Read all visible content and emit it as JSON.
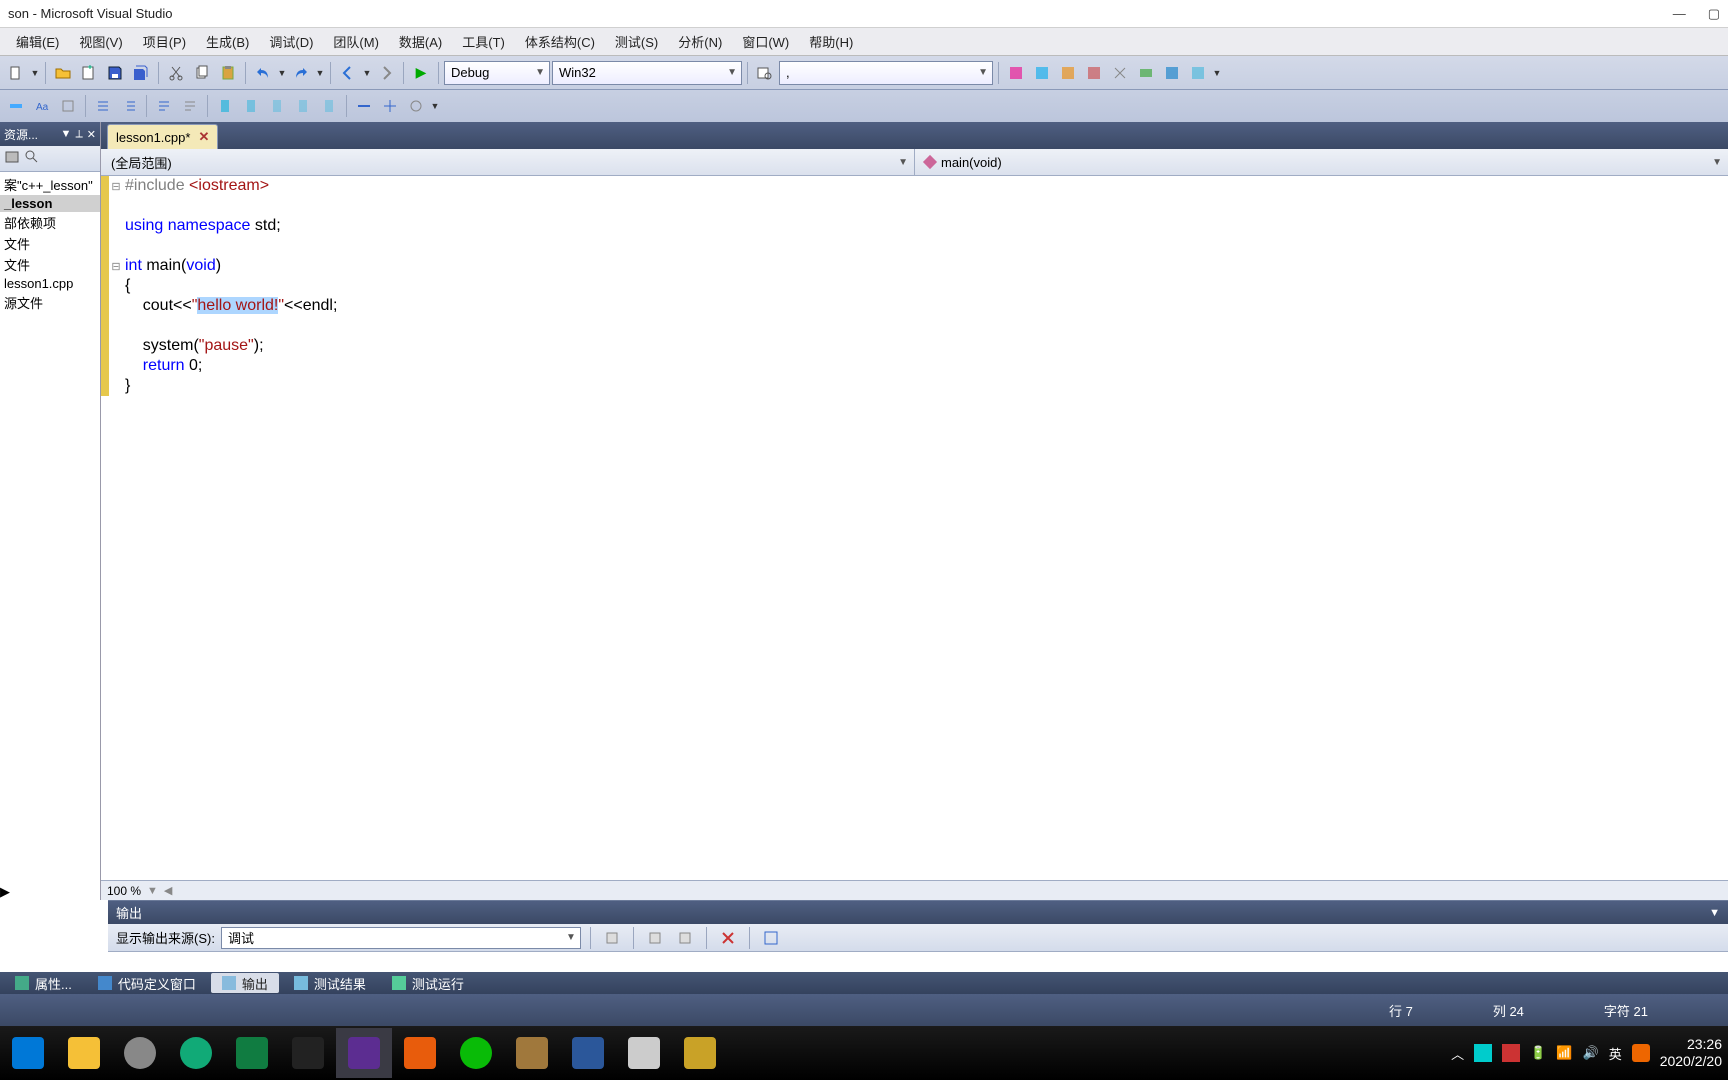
{
  "title": "son - Microsoft Visual Studio",
  "menu": [
    "编辑(E)",
    "视图(V)",
    "项目(P)",
    "生成(B)",
    "调试(D)",
    "团队(M)",
    "数据(A)",
    "工具(T)",
    "体系结构(C)",
    "测试(S)",
    "分析(N)",
    "窗口(W)",
    "帮助(H)"
  ],
  "toolbar": {
    "config": "Debug",
    "platform": "Win32",
    "find": ","
  },
  "explorer": {
    "header": "资源...",
    "root": "案\"c++_lesson\"",
    "items": [
      "_lesson",
      "部依赖项",
      "文件",
      "文件",
      "lesson1.cpp",
      "源文件"
    ],
    "selectedIndex": 0
  },
  "tab": {
    "name": "lesson1.cpp*",
    "dirty": true
  },
  "scope": {
    "left": "(全局范围)",
    "right": "main(void)"
  },
  "code": {
    "l1_pp": "#include ",
    "l1_inc": "<iostream>",
    "l3_kw1": "using ",
    "l3_kw2": "namespace",
    "l3_rest": " std;",
    "l5_kw1": "int",
    "l5_mid": " main(",
    "l5_kw2": "void",
    "l5_end": ")",
    "l6": "{",
    "l7_pre": "    cout<<",
    "l7_q1": "\"",
    "l7_sel": "hello world!",
    "l7_q2": "\"",
    "l7_post": "<<endl;",
    "l9_pre": "    system(",
    "l9_str": "\"pause\"",
    "l9_post": ");",
    "l10_kw": "    return",
    "l10_post": " 0;",
    "l11": "}"
  },
  "zoom": "100 %",
  "output": {
    "title": "输出",
    "srcLabel": "显示输出来源(S):",
    "srcValue": "调试"
  },
  "bottomTabs": [
    "属性...",
    "代码定义窗口",
    "输出",
    "测试结果",
    "测试运行"
  ],
  "bottomSelected": 2,
  "status": {
    "row": "行 7",
    "col": "列 24",
    "chr": "字符 21"
  },
  "systray": {
    "ime": "英",
    "time": "23:26",
    "date": "2020/2/20"
  },
  "icons": {
    "new": "new-icon",
    "open": "open-icon",
    "save": "save-icon",
    "saveall": "saveall-icon",
    "cut": "cut-icon",
    "copy": "copy-icon",
    "paste": "paste-icon",
    "undo": "undo-icon",
    "redo": "redo-icon",
    "nav": "nav-icon",
    "nav2": "nav2-icon",
    "play": "play-icon",
    "ext": "ext-icon"
  }
}
